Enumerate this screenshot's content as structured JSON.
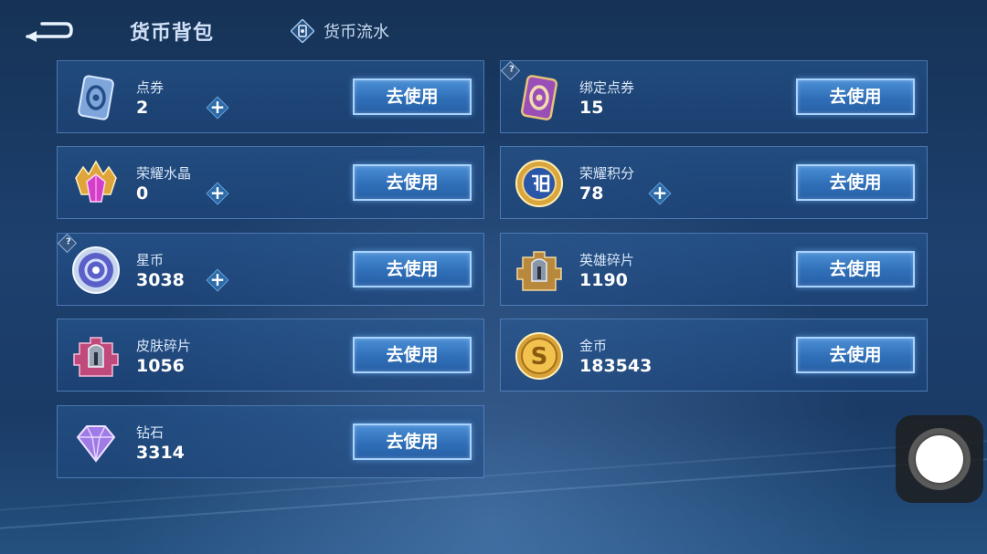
{
  "header": {
    "title": "货币背包",
    "flow_label": "货币流水"
  },
  "items": [
    {
      "name": "点券",
      "amount": "2",
      "button": "去使用",
      "icon": "ticket-icon",
      "has_plus": true,
      "has_help": false
    },
    {
      "name": "绑定点券",
      "amount": "15",
      "button": "去使用",
      "icon": "bound-ticket-icon",
      "has_plus": false,
      "has_help": true
    },
    {
      "name": "荣耀水晶",
      "amount": "0",
      "button": "去使用",
      "icon": "glory-crystal-icon",
      "has_plus": true,
      "has_help": false
    },
    {
      "name": "荣耀积分",
      "amount": "78",
      "button": "去使用",
      "icon": "glory-points-icon",
      "has_plus": true,
      "has_help": false
    },
    {
      "name": "星币",
      "amount": "3038",
      "button": "去使用",
      "icon": "star-coin-icon",
      "has_plus": true,
      "has_help": true
    },
    {
      "name": "英雄碎片",
      "amount": "1190",
      "button": "去使用",
      "icon": "hero-fragment-icon",
      "has_plus": false,
      "has_help": false
    },
    {
      "name": "皮肤碎片",
      "amount": "1056",
      "button": "去使用",
      "icon": "skin-fragment-icon",
      "has_plus": false,
      "has_help": false
    },
    {
      "name": "金币",
      "amount": "183543",
      "button": "去使用",
      "icon": "gold-coin-icon",
      "has_plus": false,
      "has_help": false
    },
    {
      "name": "钻石",
      "amount": "3314",
      "button": "去使用",
      "icon": "diamond-icon",
      "has_plus": false,
      "has_help": false
    }
  ],
  "help_symbol": "?",
  "plus_symbol": "+",
  "icons": {
    "back": "back-arrow-icon",
    "flow": "currency-flow-icon",
    "assist": "assistive-touch-icon"
  },
  "colors": {
    "button_fill": "#2f6fb8",
    "button_border": "#a9d3ff",
    "card_border": "#6ea0dc"
  }
}
